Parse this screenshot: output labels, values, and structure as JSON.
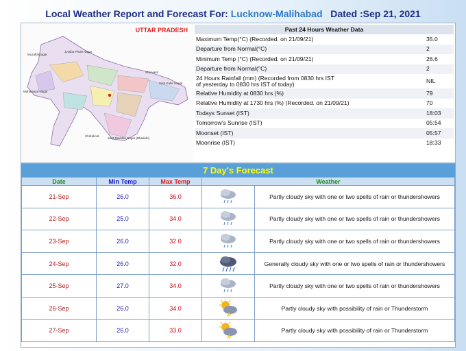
{
  "header": {
    "prefix": "Local Weather Report and Forecast For:",
    "location": "Lucknow-Malihabad",
    "date_label": "Dated :Sep 21, 2021"
  },
  "map": {
    "state_label": "UTTAR PRADESH",
    "district_labels": [
      "Jyotiba Phule Nagar",
      "Muzaffarnagar",
      "Shravasti",
      "Sant Kabir Nagar",
      "Mahamaya Nagar",
      "Chitrakoot",
      "Sant Ravidas Nagar (Bhadohi)"
    ]
  },
  "past24": {
    "heading": "Past 24 Hours Weather Data",
    "rows": [
      {
        "label": "Maximum Temp(°C) (Recorded. on 21/09/21)",
        "value": "35.0"
      },
      {
        "label": "Departure from Normal(°C)",
        "value": "2"
      },
      {
        "label": "Minimum Temp (°C) (Recorded. on 21/09/21)",
        "value": "26.6"
      },
      {
        "label": "Departure from Normal(°C)",
        "value": "2"
      },
      {
        "label": "24 Hours Rainfall (mm) (Recorded from 0830 hrs IST",
        "label2": "of yesterday to 0830 hrs IST of today)",
        "value": "NIL"
      },
      {
        "label": "Relative Humidity at 0830 hrs (%)",
        "value": "79"
      },
      {
        "label": "Relative Humidity at 1730 hrs (%) (Recorded. on 21/09/21)",
        "value": "70"
      },
      {
        "label": "Todays Sunset (IST)",
        "value": "18:03"
      },
      {
        "label": "Tomorrow's Sunrise (IST)",
        "value": "05:54"
      },
      {
        "label": "Moonset (IST)",
        "value": "05:57"
      },
      {
        "label": "Moonrise (IST)",
        "value": "18:33"
      }
    ]
  },
  "forecast": {
    "title": "7 Day's Forecast",
    "columns": {
      "date": "Date",
      "min": "Min Temp",
      "max": "Max Temp",
      "weather": "Weather"
    },
    "rows": [
      {
        "date": "21-Sep",
        "min": "26.0",
        "max": "36.0",
        "icon": "cloud-rain-icon",
        "desc": "Partly cloudy sky with one or two spells of rain or thundershowers"
      },
      {
        "date": "22-Sep",
        "min": "25.0",
        "max": "34.0",
        "icon": "cloud-rain-icon",
        "desc": "Partly cloudy sky with one or two spells of rain or thundershowers"
      },
      {
        "date": "23-Sep",
        "min": "26.0",
        "max": "32.0",
        "icon": "cloud-rain-icon",
        "desc": "Partly cloudy sky with one or two spells of rain or thundershowers"
      },
      {
        "date": "24-Sep",
        "min": "26.0",
        "max": "32.0",
        "icon": "dark-cloud-rain-icon",
        "desc": "Generally cloudy sky with one or two spells of rain or thundershowers"
      },
      {
        "date": "25-Sep",
        "min": "27.0",
        "max": "34.0",
        "icon": "cloud-rain-icon",
        "desc": "Partly cloudy sky with one or two spells of rain or thundershowers"
      },
      {
        "date": "26-Sep",
        "min": "26.0",
        "max": "34.0",
        "icon": "sun-thunder-icon",
        "desc": "Partly cloudy sky with possibility of rain or Thunderstorm"
      },
      {
        "date": "27-Sep",
        "min": "26.0",
        "max": "33.0",
        "icon": "sun-thunder-icon",
        "desc": "Partly cloudy sky with possibility of rain or Thunderstorm"
      }
    ]
  },
  "colors": {
    "title": "#1b2c86",
    "location": "#2f78c9",
    "forecast_bar": "#5aa0d8",
    "forecast_title": "#ffff00"
  }
}
